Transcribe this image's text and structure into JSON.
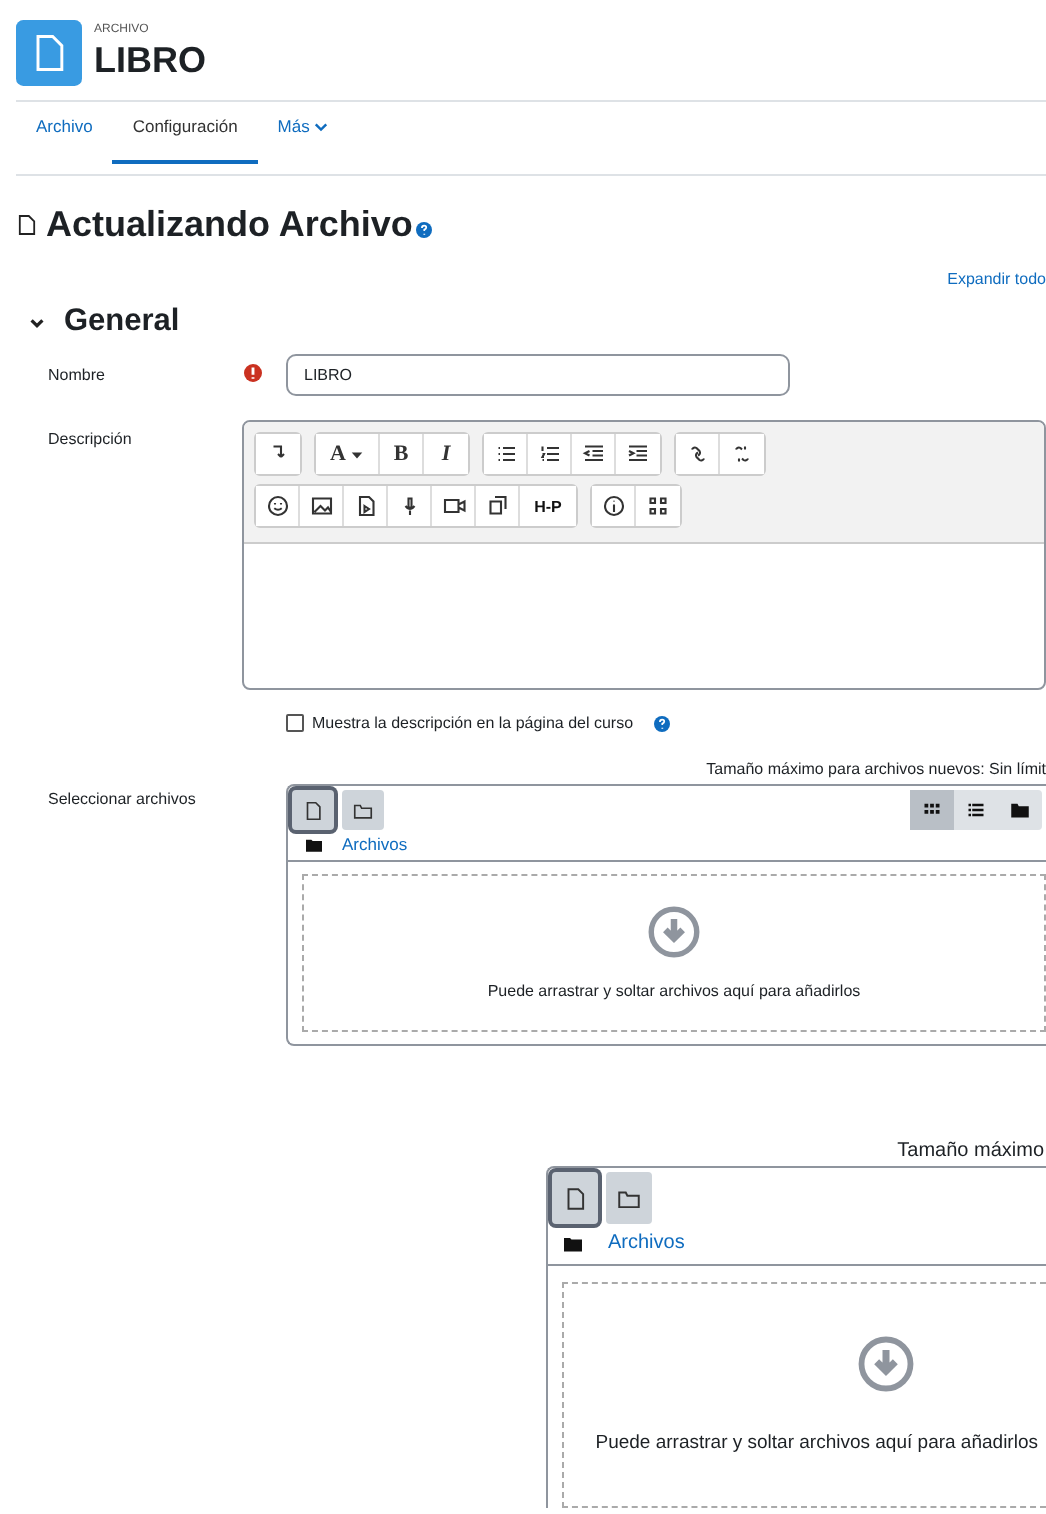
{
  "header": {
    "context": "ARCHIVO",
    "title": "LIBRO"
  },
  "tabs": [
    {
      "label": "Archivo",
      "selected": false,
      "has_menu": false
    },
    {
      "label": "Configuración",
      "selected": true,
      "has_menu": false
    },
    {
      "label": "Más",
      "selected": false,
      "has_menu": true
    }
  ],
  "page_title": "Actualizando Archivo",
  "expand_all": "Expandir todo",
  "section": {
    "title": "General",
    "expanded": true
  },
  "name_field": {
    "label": "Nombre",
    "required": true,
    "value": "LIBRO"
  },
  "description": {
    "label": "Descripción",
    "toolbar": [
      [
        [
          {
            "kind": "para"
          }
        ],
        [
          {
            "kind": "font",
            "label": "A"
          },
          {
            "kind": "bold",
            "label": "B"
          },
          {
            "kind": "italic",
            "label": "I"
          }
        ],
        [
          {
            "kind": "bullets"
          },
          {
            "kind": "numbers"
          },
          {
            "kind": "outdent"
          },
          {
            "kind": "indent"
          }
        ],
        [
          {
            "kind": "link"
          },
          {
            "kind": "unlink"
          }
        ]
      ],
      [
        [
          {
            "kind": "emoji"
          },
          {
            "kind": "image"
          },
          {
            "kind": "media"
          },
          {
            "kind": "mic"
          },
          {
            "kind": "video"
          },
          {
            "kind": "copy"
          },
          {
            "kind": "h5p",
            "label": "H-P"
          }
        ],
        [
          {
            "kind": "info"
          },
          {
            "kind": "grid"
          }
        ]
      ]
    ]
  },
  "show_description": {
    "label": "Muestra la descripción en la página del curso",
    "checked": false
  },
  "files": {
    "label": "Seleccionar archivos",
    "max_size": "Tamaño máximo para archivos nuevos: Sin límit",
    "path": "Archivos",
    "drop_hint": "Puede arrastrar y soltar archivos aquí para añadirlos",
    "view_modes": [
      {
        "kind": "icons",
        "selected": true
      },
      {
        "kind": "list",
        "selected": false
      },
      {
        "kind": "tree",
        "selected": false
      }
    ]
  },
  "zoomed_picker": {
    "max_size": "Tamaño máximo",
    "path": "Archivos",
    "drop_hint": "Puede arrastrar y soltar archivos aquí para añadirlos"
  }
}
